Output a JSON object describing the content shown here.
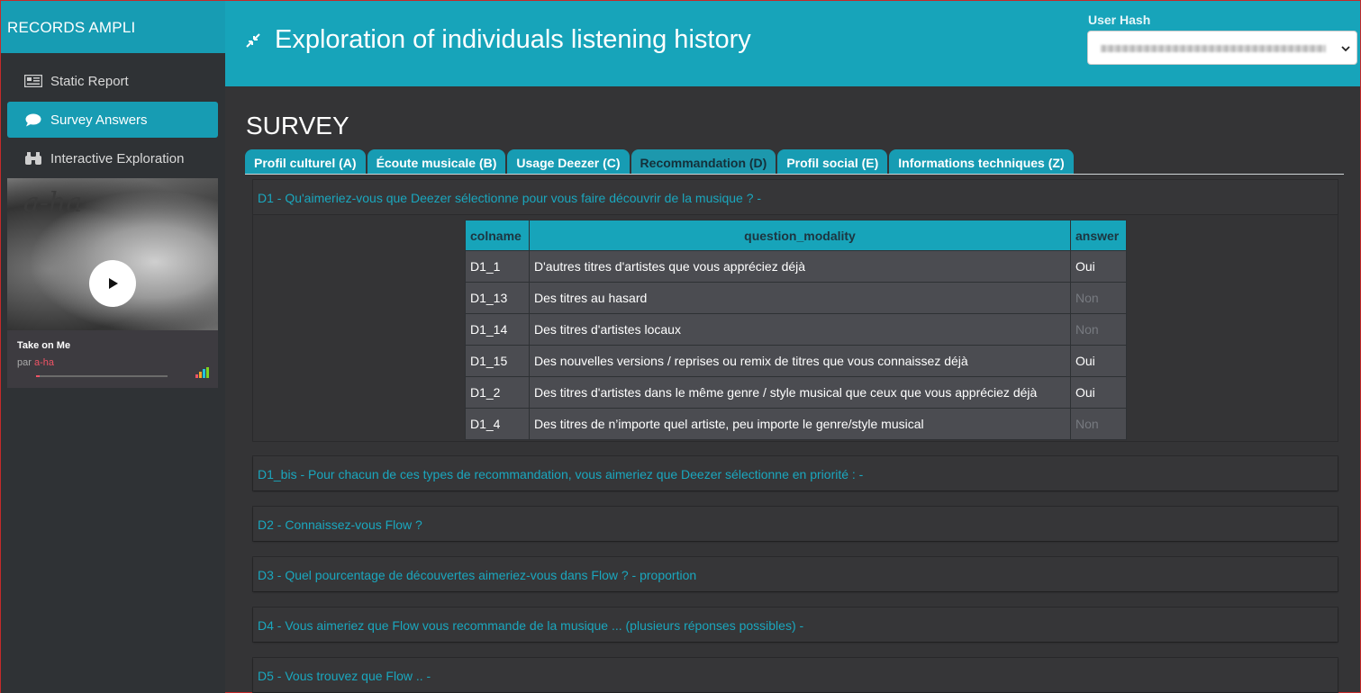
{
  "sidebar": {
    "brand": "RECORDS AMPLI",
    "items": [
      {
        "label": "Static Report",
        "icon": "newspaper-icon"
      },
      {
        "label": "Survey Answers",
        "icon": "comment-icon"
      },
      {
        "label": "Interactive Exploration",
        "icon": "binoculars-icon"
      }
    ]
  },
  "player": {
    "album_logo": "a-ha",
    "track": "Take on Me",
    "by_prefix": "par",
    "artist": "a-ha",
    "progress": 0.03
  },
  "header": {
    "title": "Exploration of individuals listening history",
    "user_hash_label": "User Hash"
  },
  "main": {
    "section_title": "SURVEY",
    "tabs": [
      {
        "label": "Profil culturel (A)"
      },
      {
        "label": "Écoute musicale (B)"
      },
      {
        "label": "Usage Deezer (C)"
      },
      {
        "label": "Recommandation (D)"
      },
      {
        "label": "Profil social (E)"
      },
      {
        "label": "Informations techniques (Z)"
      }
    ],
    "panels": [
      {
        "title": "D1 - Qu'aimeriez-vous que Deezer sélectionne pour vous faire découvrir de la musique ? -"
      },
      {
        "title": "D1_bis - Pour chacun de ces types de recommandation, vous aimeriez que Deezer sélectionne en priorité : -"
      },
      {
        "title": "D2 - Connaissez-vous Flow ?"
      },
      {
        "title": "D3 - Quel pourcentage de découvertes aimeriez-vous dans Flow ? - proportion"
      },
      {
        "title": "D4 - Vous aimeriez que Flow vous recommande de la musique ... (plusieurs réponses possibles) -"
      },
      {
        "title": "D5 - Vous trouvez que Flow .. -"
      }
    ],
    "table": {
      "headers": [
        "colname",
        "question_modality",
        "answer"
      ],
      "rows": [
        {
          "colname": "D1_1",
          "modality": "D'autres titres d'artistes que vous appréciez déjà",
          "answer": "Oui"
        },
        {
          "colname": "D1_13",
          "modality": "Des titres au hasard",
          "answer": "Non"
        },
        {
          "colname": "D1_14",
          "modality": "Des titres d'artistes locaux",
          "answer": "Non"
        },
        {
          "colname": "D1_15",
          "modality": "Des nouvelles versions / reprises ou remix de titres que vous connaissez déjà",
          "answer": "Oui"
        },
        {
          "colname": "D1_2",
          "modality": "Des titres d'artistes dans le même genre / style musical que ceux que vous appréciez déjà",
          "answer": "Oui"
        },
        {
          "colname": "D1_4",
          "modality": "Des titres de n’importe quel artiste, peu importe le genre/style musical",
          "answer": "Non"
        }
      ]
    }
  },
  "colors": {
    "accent": "#17a4ba",
    "sidebar_bg": "#2f3235",
    "body_bg": "#343436",
    "link": "#1aa7be",
    "artist": "#ef5466"
  }
}
